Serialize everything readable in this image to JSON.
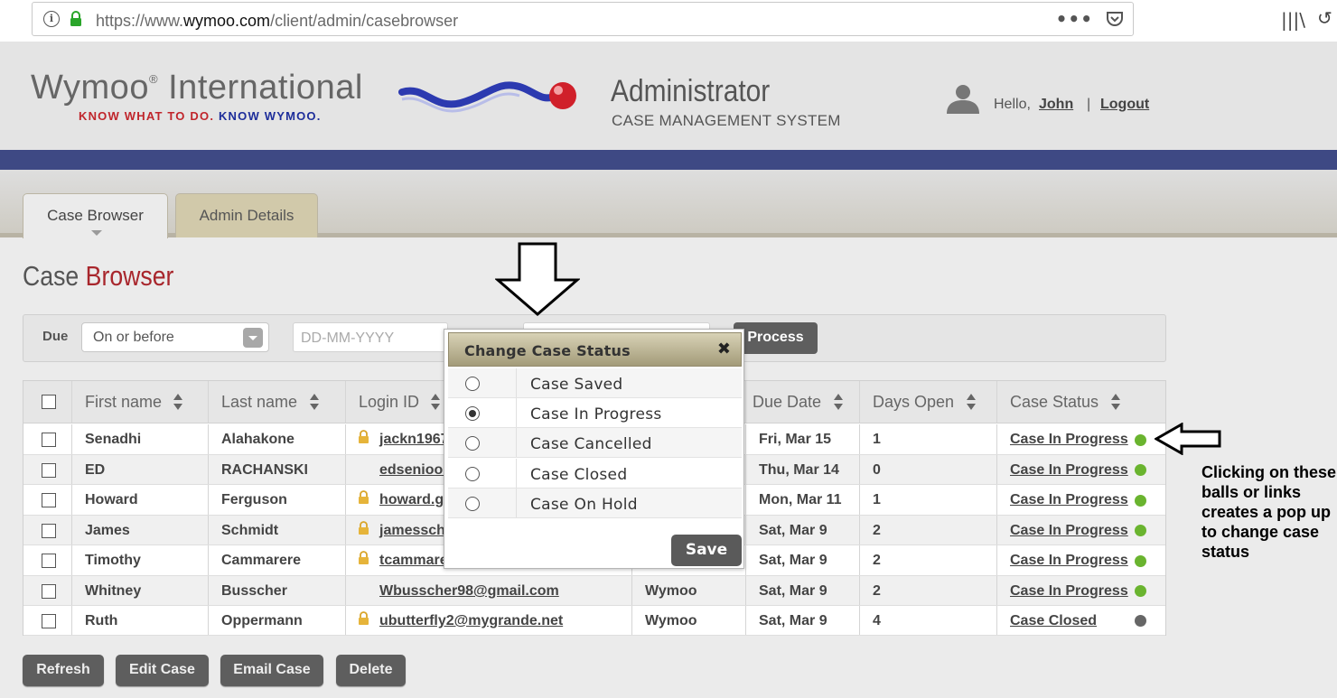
{
  "browser": {
    "url_prefix": "https://www.",
    "url_domain": "wymoo.com",
    "url_path": "/client/admin/casebrowser",
    "menu_dots": "•••"
  },
  "header": {
    "logo_word": "Wymoo",
    "logo_reg": "®",
    "logo_word2": "International",
    "tagline_1": "KNOW WHAT TO DO.",
    "tagline_2": "KNOW WYMOO.",
    "app_title": "Administrator",
    "app_subtitle": "CASE MANAGEMENT SYSTEM",
    "greeting": "Hello,",
    "user_name": "John",
    "separator": "|",
    "logout_label": "Logout"
  },
  "tabs": [
    {
      "label": "Case Browser",
      "active": true
    },
    {
      "label": "Admin Details",
      "active": false
    }
  ],
  "page": {
    "title_part1": "Case",
    "title_part2": "Browser"
  },
  "filter": {
    "label": "Due",
    "select_value": "On or before",
    "date_placeholder": "DD-MM-YYYY",
    "process_label": "Process"
  },
  "table": {
    "columns": [
      "First name",
      "Last name",
      "Login ID",
      "",
      "Due Date",
      "Days Open",
      "Case Status"
    ],
    "rows": [
      {
        "first": "Senadhi",
        "last": "Alahakone",
        "login": "jackn1967",
        "locked": true,
        "company": "",
        "due": "Fri, Mar 15",
        "days": "1",
        "status": "Case In Progress",
        "status_color": "#6ab42f"
      },
      {
        "first": "ED",
        "last": "RACHANSKI",
        "login": "edsenioor",
        "locked": false,
        "company": "",
        "due": "Thu, Mar 14",
        "days": "0",
        "status": "Case In Progress",
        "status_color": "#6ab42f"
      },
      {
        "first": "Howard",
        "last": "Ferguson",
        "login": "howard.g",
        "locked": true,
        "company": "",
        "due": "Mon, Mar 11",
        "days": "1",
        "status": "Case In Progress",
        "status_color": "#6ab42f"
      },
      {
        "first": "James",
        "last": "Schmidt",
        "login": "jamessch",
        "locked": true,
        "company": "",
        "due": "Sat, Mar 9",
        "days": "2",
        "status": "Case In Progress",
        "status_color": "#6ab42f"
      },
      {
        "first": "Timothy",
        "last": "Cammarere",
        "login": "tcammare",
        "locked": true,
        "company": "",
        "due": "Sat, Mar 9",
        "days": "2",
        "status": "Case In Progress",
        "status_color": "#6ab42f"
      },
      {
        "first": "Whitney",
        "last": "Busscher",
        "login": "Wbusscher98@gmail.com",
        "locked": false,
        "company": "Wymoo",
        "due": "Sat, Mar 9",
        "days": "2",
        "status": "Case In Progress",
        "status_color": "#6ab42f"
      },
      {
        "first": "Ruth",
        "last": "Oppermann",
        "login": "ubutterfly2@mygrande.net",
        "locked": true,
        "company": "Wymoo",
        "due": "Sat, Mar 9",
        "days": "4",
        "status": "Case Closed",
        "status_color": "#666666"
      }
    ]
  },
  "actions": {
    "refresh": "Refresh",
    "edit": "Edit Case",
    "email": "Email Case",
    "delete": "Delete"
  },
  "popup": {
    "title": "Change Case Status",
    "close": "✖",
    "options": [
      {
        "label": "Case Saved",
        "checked": false
      },
      {
        "label": "Case In Progress",
        "checked": true
      },
      {
        "label": "Case Cancelled",
        "checked": false
      },
      {
        "label": "Case Closed",
        "checked": false
      },
      {
        "label": "Case On Hold",
        "checked": false
      }
    ],
    "save_label": "Save"
  },
  "annotation": {
    "note": "Clicking on these balls or links creates a pop up to change case status"
  },
  "colors": {
    "brand_red": "#a8262c",
    "brand_blue": "#3e4984",
    "in_progress": "#6ab42f",
    "closed": "#666666"
  }
}
